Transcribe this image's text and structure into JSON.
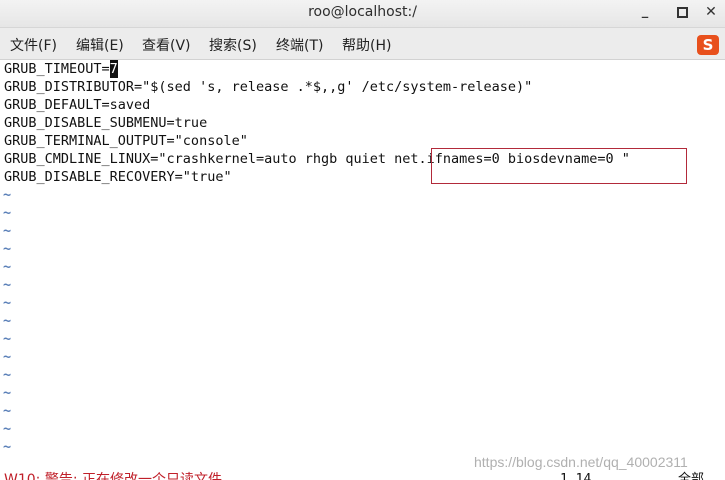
{
  "window": {
    "title": "roo@localhost:/",
    "minimize_glyph": "_",
    "close_glyph": "✕"
  },
  "menu": {
    "items": [
      "文件(F)",
      "编辑(E)",
      "查看(V)",
      "搜索(S)",
      "终端(T)",
      "帮助(H)"
    ]
  },
  "tray": {
    "ime_label": "S"
  },
  "editor": {
    "lines": [
      "GRUB_TIMEOUT=",
      "GRUB_DISTRIBUTOR=\"$(sed 's, release .*$,,g' /etc/system-release)\"",
      "GRUB_DEFAULT=saved",
      "GRUB_DISABLE_SUBMENU=true",
      "GRUB_TERMINAL_OUTPUT=\"console\"",
      "GRUB_CMDLINE_LINUX=\"crashkernel=auto rhgb quiet net.ifnames=0 biosdevname=0 \"",
      "GRUB_DISABLE_RECOVERY=\"true\""
    ],
    "cursor_char": "7",
    "empty_line_marker": "~",
    "highlighted_text": "net.ifnames=0 biosdevname=0"
  },
  "status": {
    "message": "W10: 警告: 正在修改一个只读文件",
    "position": "1,14",
    "scroll": "全部"
  },
  "watermark": "https://blog.csdn.net/qq_40002311",
  "colors": {
    "tilde": "#5a7fb8",
    "highlight_border": "#b22a3a",
    "warning_text": "#c0202a",
    "ime_icon": "#e8501c"
  }
}
